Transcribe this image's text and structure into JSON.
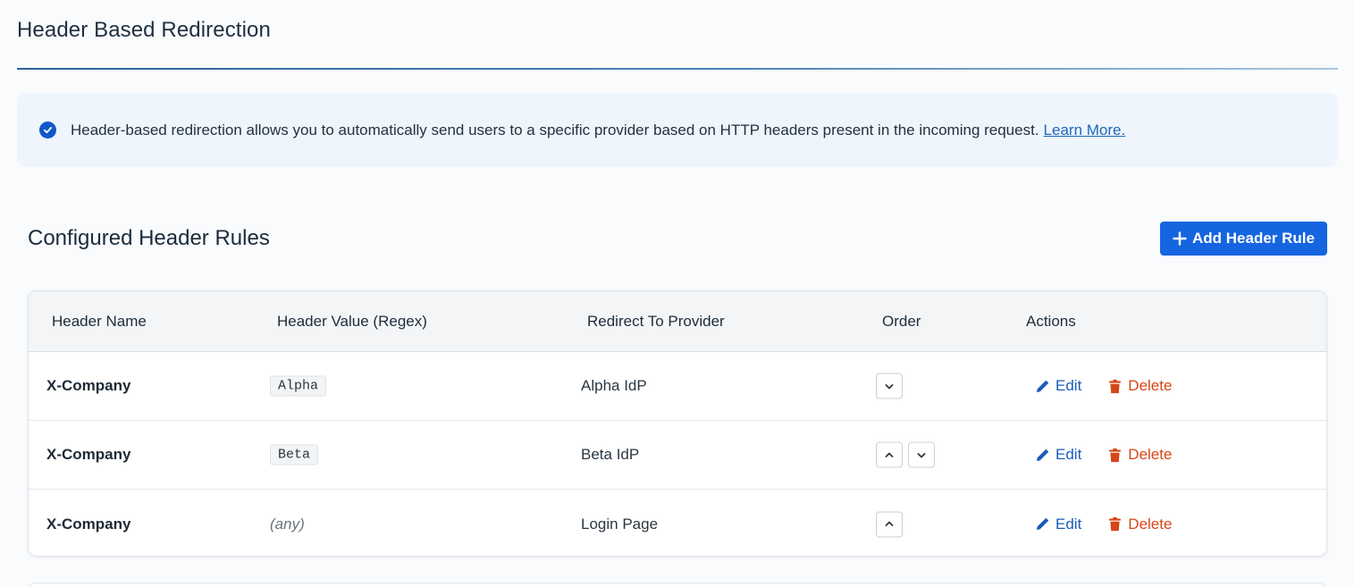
{
  "page": {
    "title": "Header Based Redirection"
  },
  "info": {
    "text": "Header-based redirection allows you to automatically send users to a specific provider based on HTTP headers present in the incoming request.",
    "link_label": "Learn More.",
    "icon": "check-circle-icon"
  },
  "rules": {
    "section_title": "Configured Header Rules",
    "add_button_label": "Add Header Rule",
    "columns": [
      "Header Name",
      "Header Value (Regex)",
      "Redirect To Provider",
      "Order",
      "Actions"
    ],
    "rows": [
      {
        "name": "X-Company",
        "value": "Alpha",
        "provider": "Alpha IdP"
      },
      {
        "name": "X-Company",
        "value": "Beta",
        "provider": "Beta IdP"
      },
      {
        "name": "X-Company",
        "value": "(any)",
        "provider": "Login Page"
      }
    ],
    "edit_label": "Edit",
    "delete_label": "Delete"
  },
  "colors": {
    "accent": "#1565e0",
    "link": "#1a5bb8",
    "danger": "#d54618",
    "banner_bg": "#eef5fc"
  }
}
